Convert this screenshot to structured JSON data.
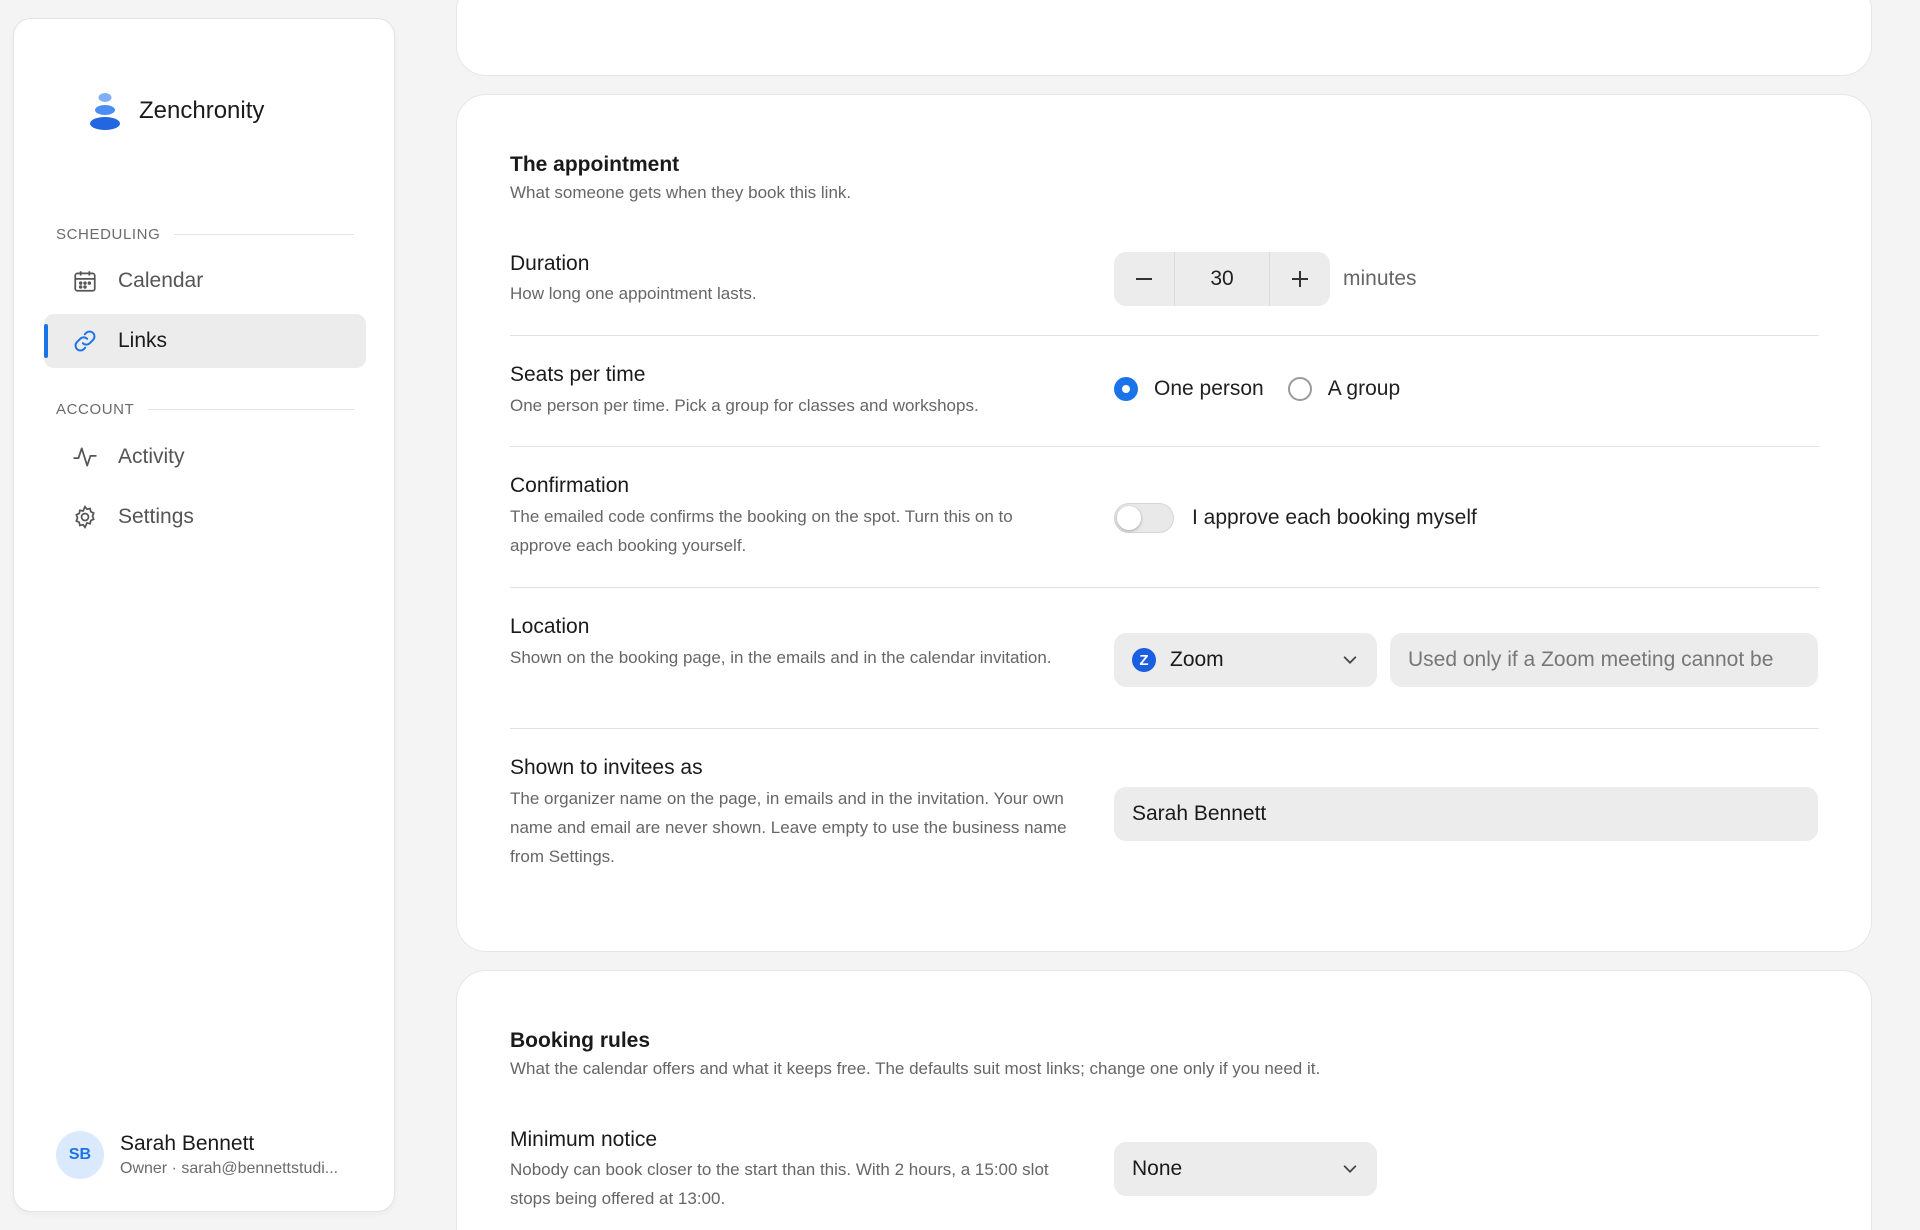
{
  "brand": {
    "name": "Zenchronity"
  },
  "sidebar": {
    "section_scheduling": "SCHEDULING",
    "section_account": "ACCOUNT",
    "items": [
      {
        "label": "Calendar",
        "icon": "calendar-icon"
      },
      {
        "label": "Links",
        "icon": "link-icon",
        "active": true
      },
      {
        "label": "Activity",
        "icon": "activity-icon"
      },
      {
        "label": "Settings",
        "icon": "gear-icon"
      }
    ],
    "user": {
      "initials": "SB",
      "name": "Sarah Bennett",
      "subtitle": "Owner · sarah@bennettstudi..."
    }
  },
  "appointment": {
    "title": "The appointment",
    "subtitle": "What someone gets when they book this link.",
    "duration": {
      "label": "Duration",
      "desc": "How long one appointment lasts.",
      "value": "30",
      "unit": "minutes"
    },
    "seats": {
      "label": "Seats per time",
      "desc": "One person per time. Pick a group for classes and workshops.",
      "options": [
        "One person",
        "A group"
      ],
      "selected": "One person"
    },
    "confirmation": {
      "label": "Confirmation",
      "desc": "The emailed code confirms the booking on the spot. Turn this on to approve each booking yourself.",
      "toggle_label": "I approve each booking myself",
      "enabled": false
    },
    "location": {
      "label": "Location",
      "desc": "Shown on the booking page, in the emails and in the calendar invitation.",
      "selected": "Zoom",
      "fallback_placeholder": "Used only if a Zoom meeting cannot be"
    },
    "shown_as": {
      "label": "Shown to invitees as",
      "desc": "The organizer name on the page, in emails and in the invitation. Your own name and email are never shown. Leave empty to use the business name from Settings.",
      "value": "Sarah Bennett"
    }
  },
  "booking_rules": {
    "title": "Booking rules",
    "subtitle": "What the calendar offers and what it keeps free. The defaults suit most links; change one only if you need it.",
    "minimum_notice": {
      "label": "Minimum notice",
      "desc": "Nobody can book closer to the start than this. With 2 hours, a 15:00 slot stops being offered at 13:00.",
      "selected": "None"
    }
  },
  "colors": {
    "accent": "#1a73e8",
    "zoom": "#1a5fe0"
  }
}
